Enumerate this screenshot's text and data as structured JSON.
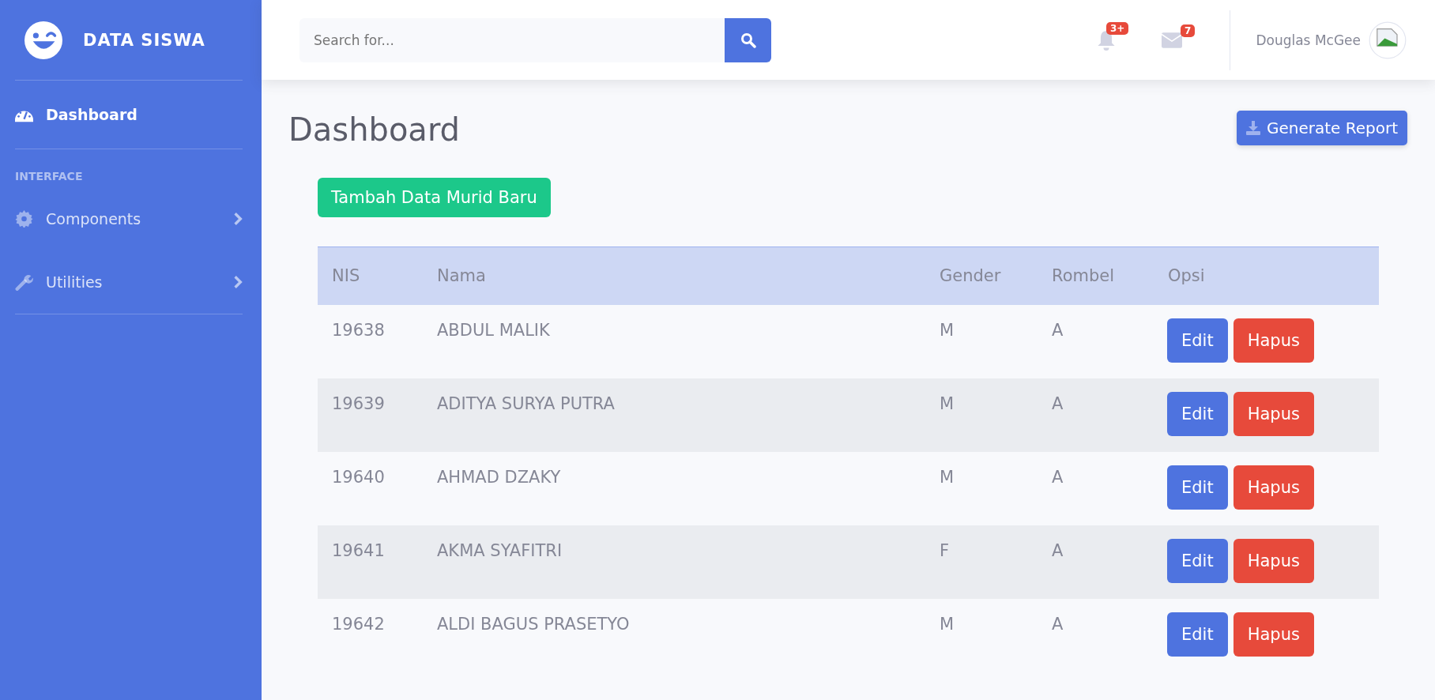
{
  "sidebar": {
    "brand": "DATA SISWA",
    "items": [
      {
        "kind": "link",
        "label": "Dashboard",
        "selected": true
      },
      {
        "kind": "heading",
        "label": "INTERFACE"
      },
      {
        "kind": "collapse",
        "label": "Components",
        "selected": false
      },
      {
        "kind": "collapse",
        "label": "Utilities",
        "selected": false
      }
    ]
  },
  "topbar": {
    "search": {
      "placeholder": "Search for..."
    },
    "alerts_badge": "3+",
    "messages_badge": "7",
    "user_name": "Douglas McGee"
  },
  "page": {
    "title": "Dashboard",
    "report_button": "Generate Report",
    "add_button": "Tambah Data Murid Baru"
  },
  "table": {
    "columns": [
      "NIS",
      "Nama",
      "Gender",
      "Rombel",
      "Opsi"
    ],
    "rows": [
      {
        "nis": "19638",
        "nama": "ABDUL MALIK",
        "gender": "M",
        "rombel": "A",
        "actions": [
          "Edit",
          "Hapus"
        ]
      },
      {
        "nis": "19639",
        "nama": "ADITYA SURYA PUTRA",
        "gender": "M",
        "rombel": "A",
        "actions": [
          "Edit",
          "Hapus"
        ]
      },
      {
        "nis": "19640",
        "nama": "AHMAD DZAKY",
        "gender": "M",
        "rombel": "A",
        "actions": [
          "Edit",
          "Hapus"
        ]
      },
      {
        "nis": "19641",
        "nama": "AKMA SYAFITRI",
        "gender": "F",
        "rombel": "A",
        "actions": [
          "Edit",
          "Hapus"
        ]
      },
      {
        "nis": "19642",
        "nama": "ALDI BAGUS PRASETYO",
        "gender": "M",
        "rombel": "A",
        "actions": [
          "Edit",
          "Hapus"
        ]
      }
    ]
  }
}
